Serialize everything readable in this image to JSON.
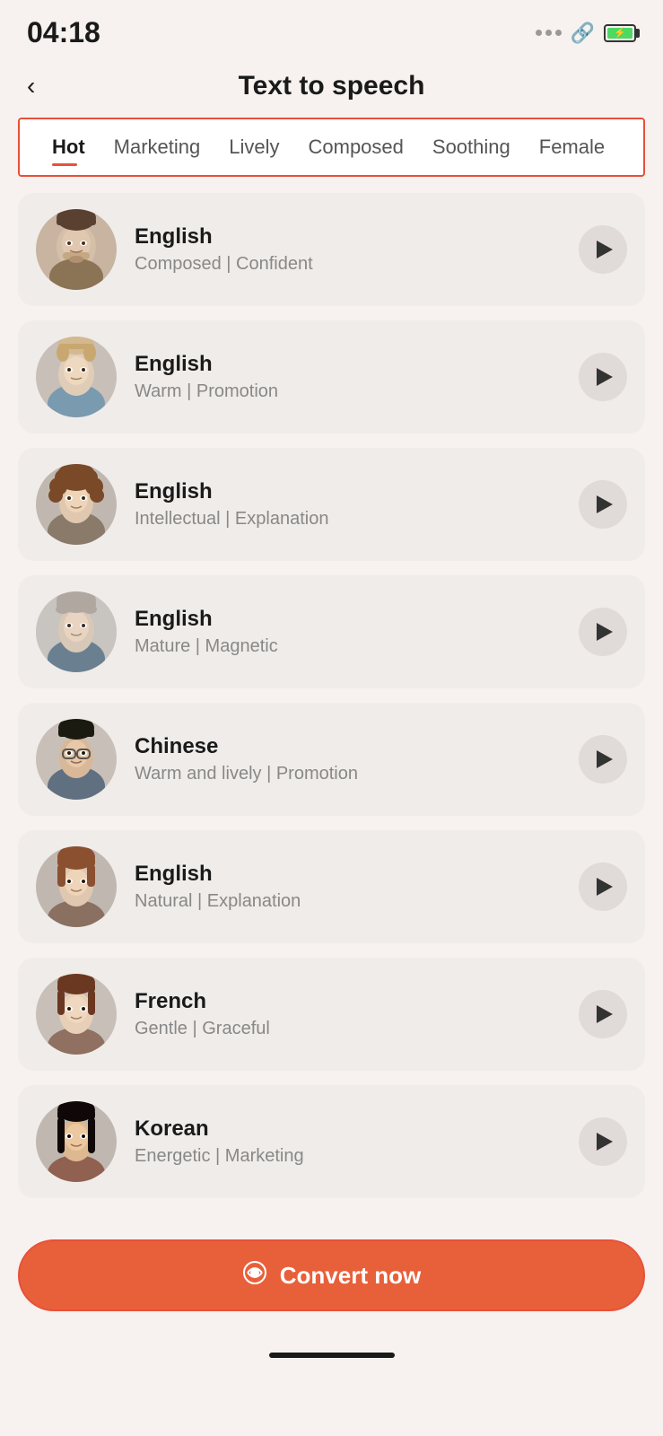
{
  "statusBar": {
    "time": "04:18"
  },
  "header": {
    "backLabel": "‹",
    "title": "Text to speech"
  },
  "tabs": [
    {
      "id": "hot",
      "label": "Hot",
      "active": true
    },
    {
      "id": "marketing",
      "label": "Marketing",
      "active": false
    },
    {
      "id": "lively",
      "label": "Lively",
      "active": false
    },
    {
      "id": "composed",
      "label": "Composed",
      "active": false
    },
    {
      "id": "soothing",
      "label": "Soothing",
      "active": false
    },
    {
      "id": "female",
      "label": "Female",
      "active": false
    }
  ],
  "voices": [
    {
      "id": 1,
      "language": "English",
      "tags": "Composed | Confident",
      "avatarClass": "av1",
      "gender": "male"
    },
    {
      "id": 2,
      "language": "English",
      "tags": "Warm | Promotion",
      "avatarClass": "av2",
      "gender": "male"
    },
    {
      "id": 3,
      "language": "English",
      "tags": "Intellectual | Explanation",
      "avatarClass": "av3",
      "gender": "female"
    },
    {
      "id": 4,
      "language": "English",
      "tags": "Mature | Magnetic",
      "avatarClass": "av4",
      "gender": "male"
    },
    {
      "id": 5,
      "language": "Chinese",
      "tags": "Warm and lively | Promotion",
      "avatarClass": "av5",
      "gender": "male"
    },
    {
      "id": 6,
      "language": "English",
      "tags": "Natural | Explanation",
      "avatarClass": "av6",
      "gender": "female"
    },
    {
      "id": 7,
      "language": "French",
      "tags": "Gentle | Graceful",
      "avatarClass": "av7",
      "gender": "female"
    },
    {
      "id": 8,
      "language": "Korean",
      "tags": "Energetic | Marketing",
      "avatarClass": "av8",
      "gender": "female"
    }
  ],
  "convertButton": {
    "label": "Convert now"
  }
}
